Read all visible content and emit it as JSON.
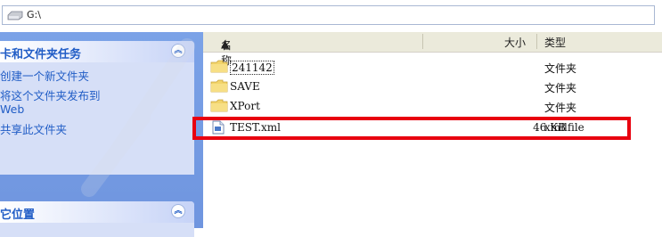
{
  "address": {
    "path": "G:\\"
  },
  "task_pane": {
    "file_tasks": {
      "title": "卡和文件夹任务",
      "items": [
        "创建一个新文件夹",
        "将这个文件夹发布到\nWeb",
        "共享此文件夹"
      ]
    },
    "places": {
      "title": "它位置"
    }
  },
  "columns": {
    "name": "名称",
    "sort_indicator": "▲",
    "size": "大小",
    "type": "类型"
  },
  "files": [
    {
      "name": "241142",
      "size": "",
      "type": "文件夹",
      "icon": "folder-icon"
    },
    {
      "name": "SAVE",
      "size": "",
      "type": "文件夹",
      "icon": "folder-icon"
    },
    {
      "name": "XPort",
      "size": "",
      "type": "文件夹",
      "icon": "folder-icon"
    },
    {
      "name": "TEST.xml",
      "size": "46 KB",
      "type": "xmllfile",
      "icon": "xml-file-icon"
    }
  ],
  "colors": {
    "highlight": "#e8000f",
    "task_link": "#215dc6",
    "pane_bg": "#7ba2e7"
  }
}
